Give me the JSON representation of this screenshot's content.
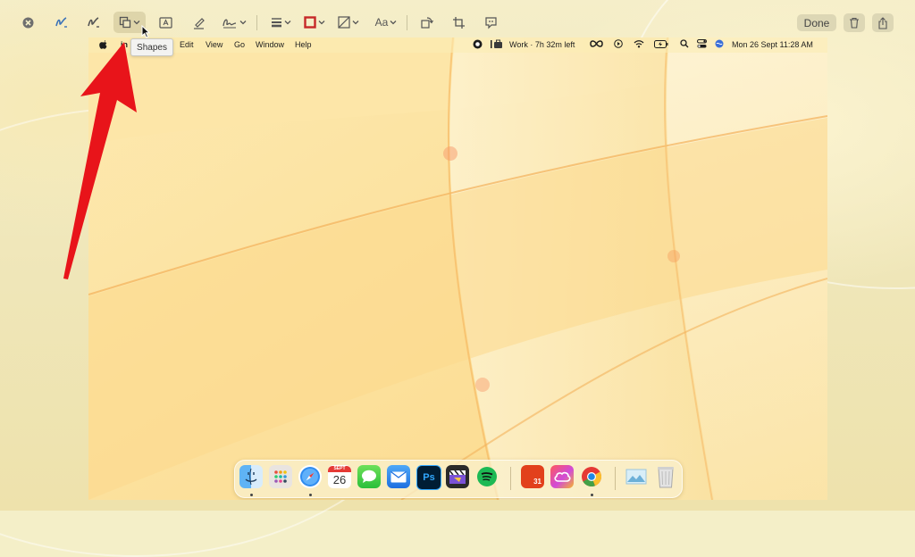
{
  "toolbar": {
    "done_label": "Done",
    "tooltip_label": "Shapes",
    "text_style_label": "Aa"
  },
  "menubar": {
    "items": [
      "Edit",
      "View",
      "Go",
      "Window",
      "Help"
    ],
    "work_status": "Work · 7h 32m left",
    "datetime": "Mon 26 Sept  11:28 AM"
  },
  "dock": {
    "calendar_month": "SEPT",
    "calendar_day": "26",
    "photoshop_label": "Ps",
    "fantastical_day": "31",
    "apps": [
      "Finder",
      "Launchpad",
      "Safari",
      "Calendar",
      "Messages",
      "Mail",
      "Photoshop",
      "Final Cut Pro",
      "Spotify",
      "Fantastical",
      "Creative Cloud",
      "Chrome",
      "Preview",
      "Trash"
    ]
  },
  "colors": {
    "arrow": "#e8141a",
    "border_tool": "#c62828",
    "wallpaper_base": "#fbe3a0"
  },
  "icons": [
    "close-icon",
    "sketch-icon",
    "draw-icon",
    "shapes-icon",
    "text-box-icon",
    "highlight-icon",
    "signature-icon",
    "line-style-icon",
    "border-color-icon",
    "fill-color-icon",
    "text-style-icon",
    "rotate-icon",
    "crop-icon",
    "annotate-icon",
    "trash-icon",
    "share-icon"
  ]
}
